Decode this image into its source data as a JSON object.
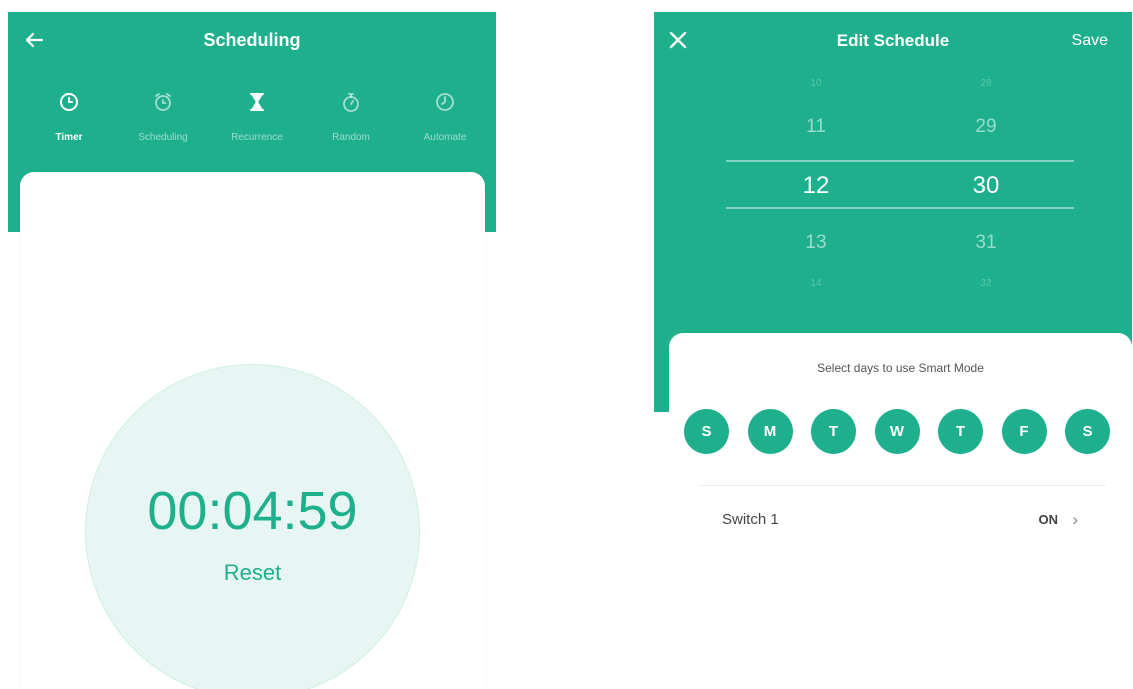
{
  "left_screen": {
    "title": "Scheduling",
    "tabs": [
      {
        "label": "Timer",
        "icon": "clock-icon",
        "active": true
      },
      {
        "label": "Scheduling",
        "icon": "alarm-clock-icon",
        "active": false
      },
      {
        "label": "Recurrence",
        "icon": "hourglass-icon",
        "active": false
      },
      {
        "label": "Random",
        "icon": "stopwatch-icon",
        "active": false
      },
      {
        "label": "Automate",
        "icon": "timer-icon",
        "active": false
      }
    ],
    "timer": {
      "value": "00:04:59",
      "reset_label": "Reset"
    }
  },
  "right_screen": {
    "title": "Edit Schedule",
    "save_label": "Save",
    "picker": {
      "hours": {
        "above": "11",
        "selected": "12",
        "below": "13"
      },
      "minutes": {
        "above": "29",
        "selected": "30",
        "below": "31"
      }
    },
    "days_title": "Select days to use Smart Mode",
    "days": [
      "S",
      "M",
      "T",
      "W",
      "T",
      "F",
      "S"
    ],
    "switch_row": {
      "label": "Switch 1",
      "value": "ON"
    }
  },
  "colors": {
    "accent": "#1eb08c",
    "circle_fill": "#e7f6f2",
    "background": "#ffffff"
  }
}
